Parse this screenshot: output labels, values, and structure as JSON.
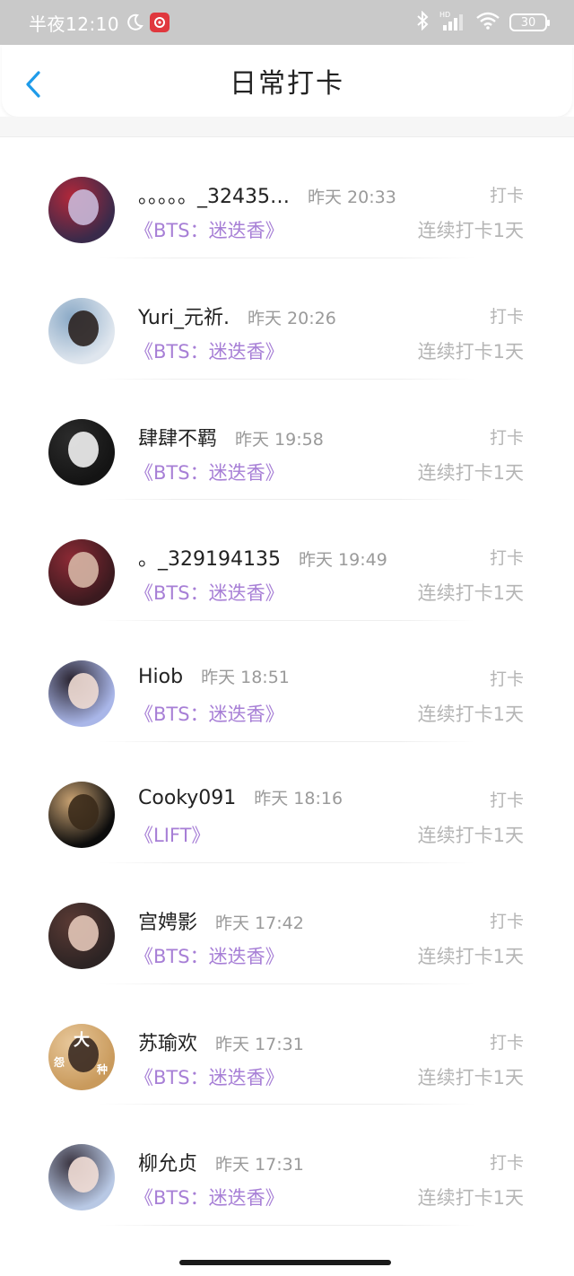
{
  "status_bar": {
    "time": "半夜12:10",
    "hd": "HD",
    "battery": "30"
  },
  "header": {
    "title": "日常打卡"
  },
  "checkins": [
    {
      "name": "。。。。。_32435…",
      "time": "昨天 20:33",
      "label": "打卡",
      "book": "《BTS：迷迭香》",
      "streak": "连续打卡1天",
      "avatar_colors": [
        "#3a2a4a",
        "#c9b8d8",
        "#b2283a"
      ]
    },
    {
      "name": "Yuri_元祈.",
      "time": "昨天 20:26",
      "label": "打卡",
      "book": "《BTS：迷迭香》",
      "streak": "连续打卡1天",
      "avatar_colors": [
        "#dfe6ee",
        "#2b2220",
        "#8aa9c6"
      ]
    },
    {
      "name": "肆肆不羁",
      "time": "昨天 19:58",
      "label": "打卡",
      "book": "《BTS：迷迭香》",
      "streak": "连续打卡1天",
      "avatar_colors": [
        "#141414",
        "#f1f1f1",
        "#2c2c2c"
      ]
    },
    {
      "name": "。_329194135",
      "time": "昨天 19:49",
      "label": "打卡",
      "book": "《BTS：迷迭香》",
      "streak": "连续打卡1天",
      "avatar_colors": [
        "#3b1a1f",
        "#d6b6a5",
        "#8c2a35"
      ]
    },
    {
      "name": "Hiob",
      "time": "昨天 18:51",
      "label": "打卡",
      "book": "《BTS：迷迭香》",
      "streak": "连续打卡1天",
      "avatar_colors": [
        "#a9b6e8",
        "#f0dcd3",
        "#2a2430"
      ]
    },
    {
      "name": "Cooky091",
      "time": "昨天 18:16",
      "label": "打卡",
      "book": "《LIFT》",
      "streak": "连续打卡1天",
      "avatar_colors": [
        "#0c0c0c",
        "#3a2a1a",
        "#c9a272"
      ]
    },
    {
      "name": "宫娉影",
      "time": "昨天 17:42",
      "label": "打卡",
      "book": "《BTS：迷迭香》",
      "streak": "连续打卡1天",
      "avatar_colors": [
        "#2d2424",
        "#e3c7b8",
        "#5a3a34"
      ]
    },
    {
      "name": "苏瑜欢",
      "time": "昨天 17:31",
      "label": "打卡",
      "book": "《BTS：迷迭香》",
      "streak": "连续打卡1天",
      "avatar_colors": [
        "#c99a5c",
        "#3a2a22",
        "#e7c79a"
      ],
      "avatar_text": [
        "大",
        "怨",
        "种"
      ]
    },
    {
      "name": "柳允贞",
      "time": "昨天 17:31",
      "label": "打卡",
      "book": "《BTS：迷迭香》",
      "streak": "连续打卡1天",
      "avatar_colors": [
        "#b8c8e4",
        "#f2ded6",
        "#3a3440"
      ]
    }
  ]
}
